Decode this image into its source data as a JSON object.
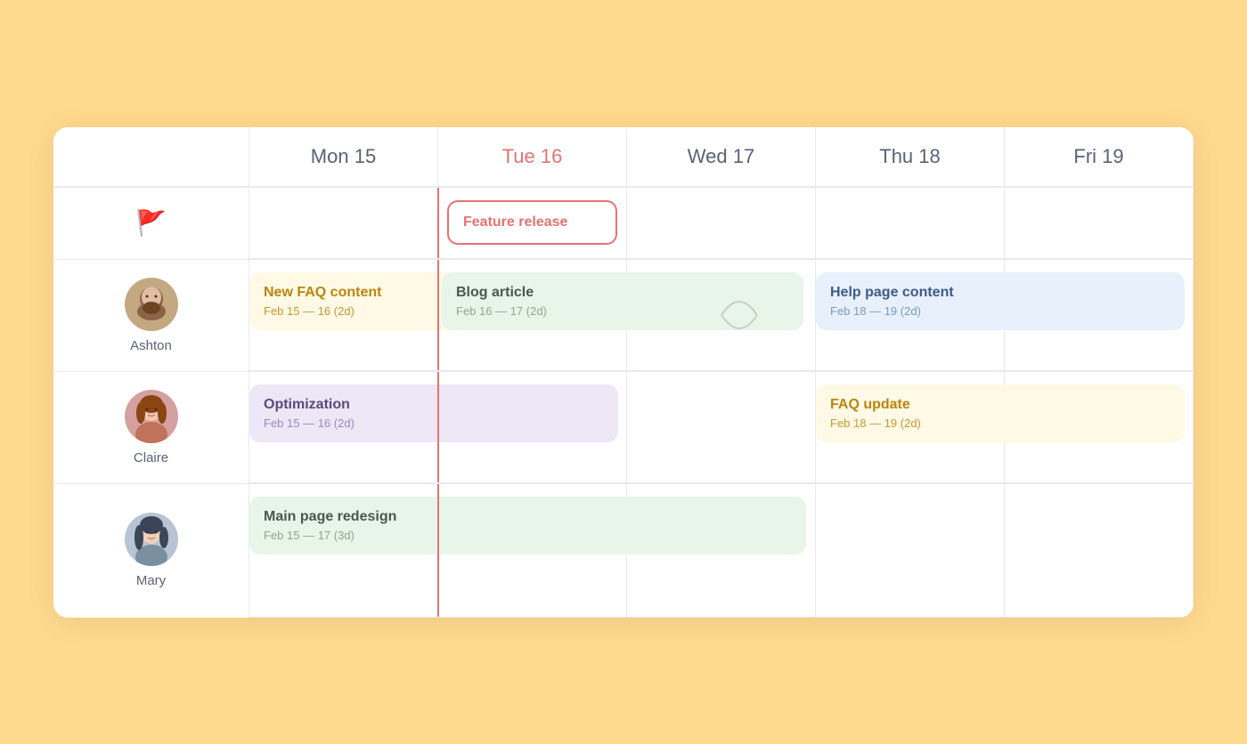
{
  "calendar": {
    "days": [
      {
        "label": "Mon 15",
        "key": "mon"
      },
      {
        "label": "Tue 16",
        "key": "tue",
        "today": true
      },
      {
        "label": "Wed 17",
        "key": "wed"
      },
      {
        "label": "Thu 18",
        "key": "thu"
      },
      {
        "label": "Fri 19",
        "key": "fri"
      }
    ],
    "colors": {
      "background": "#ffd98e",
      "today_line": "#e57373"
    }
  },
  "rows": [
    {
      "person": {
        "name": "",
        "type": "flag"
      },
      "tasks": [
        {
          "day_index": 1,
          "span": 1,
          "title": "Feature release",
          "dates": "",
          "style": "red-outline"
        }
      ]
    },
    {
      "person": {
        "name": "Ashton",
        "type": "person",
        "avatar": "ashton"
      },
      "tasks": [
        {
          "day_index": 0,
          "span": 2,
          "title": "New FAQ content",
          "dates": "Feb 15  —  16 (2d)",
          "style": "yellow"
        },
        {
          "day_index": 1,
          "span": 2,
          "title": "Blog article",
          "dates": "Feb 16  —  17 (2d)",
          "style": "green"
        },
        {
          "day_index": 3,
          "span": 2,
          "title": "Help page content",
          "dates": "Feb 18  —  19 (2d)",
          "style": "blue"
        }
      ]
    },
    {
      "person": {
        "name": "Claire",
        "type": "person",
        "avatar": "claire"
      },
      "tasks": [
        {
          "day_index": 0,
          "span": 2,
          "title": "Optimization",
          "dates": "Feb 15  —  16 (2d)",
          "style": "purple"
        },
        {
          "day_index": 3,
          "span": 2,
          "title": "FAQ update",
          "dates": "Feb 18  —  19 (2d)",
          "style": "yellow"
        }
      ]
    },
    {
      "person": {
        "name": "Mary",
        "type": "person",
        "avatar": "mary"
      },
      "tasks": [
        {
          "day_index": 0,
          "span": 3,
          "title": "Main page redesign",
          "dates": "Feb 15  —  17 (3d)",
          "style": "green"
        }
      ]
    }
  ]
}
